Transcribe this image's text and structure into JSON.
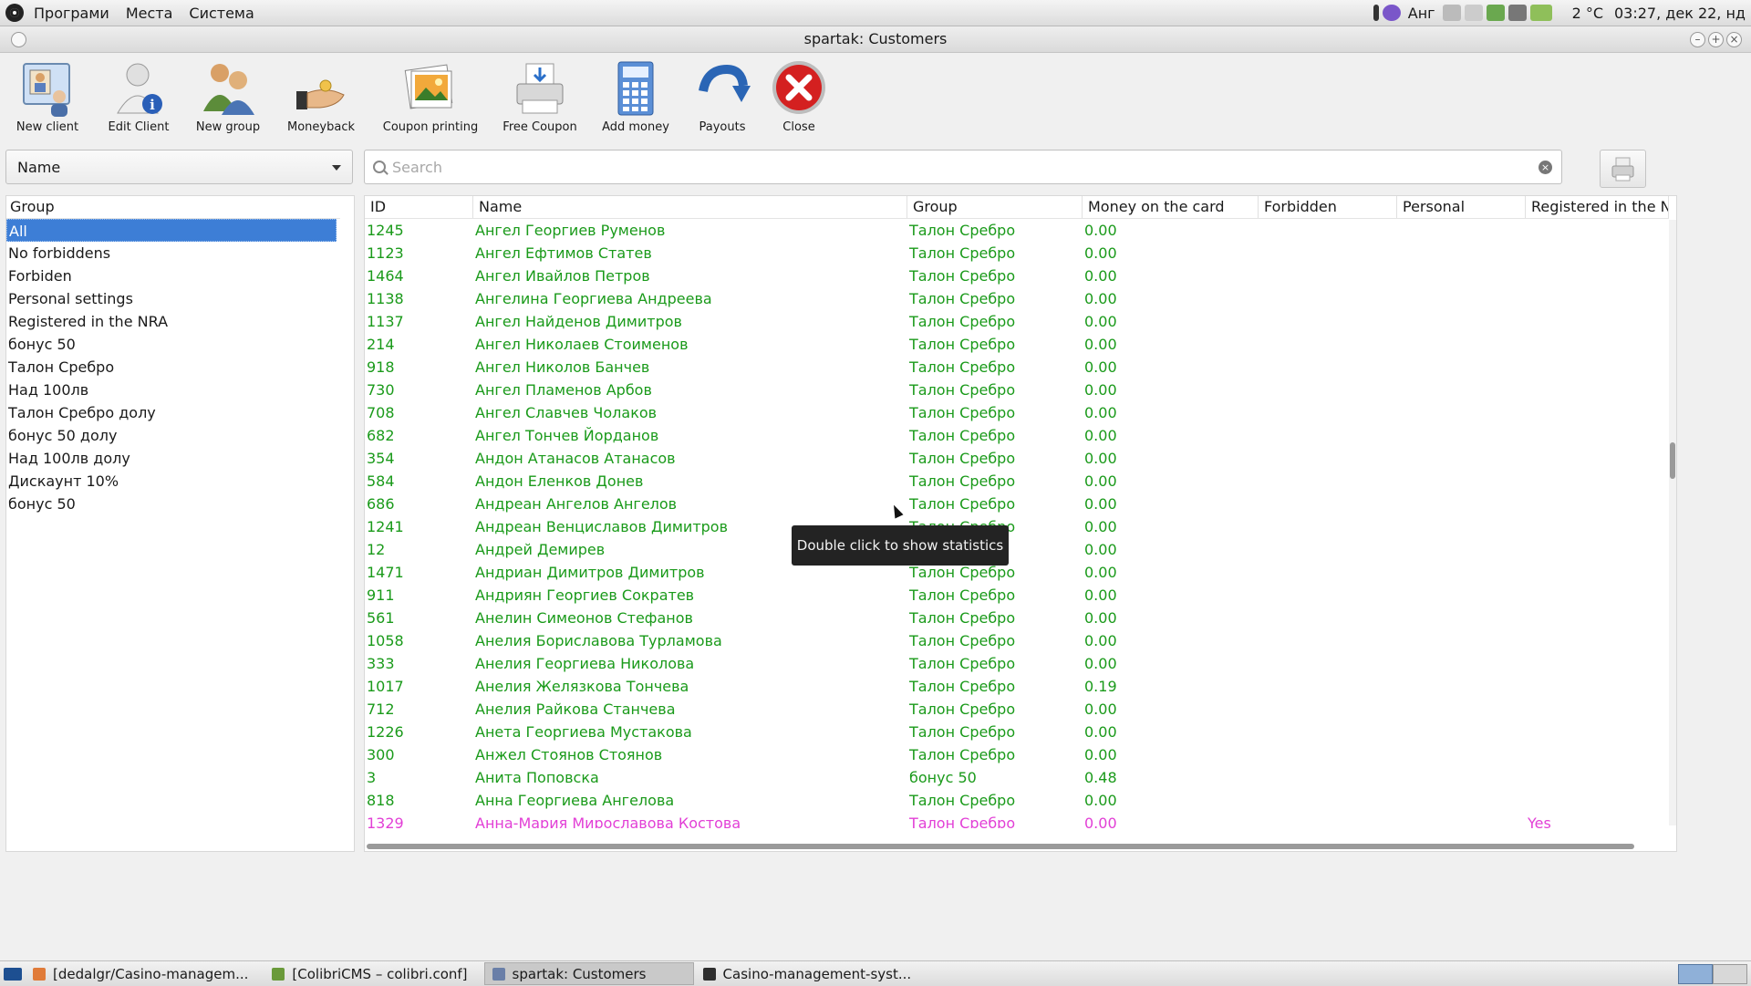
{
  "top_panel": {
    "menus": [
      "Програми",
      "Места",
      "Система"
    ],
    "tray": {
      "keyboard": "Анг",
      "temperature": "2 °C",
      "clock": "03:27, дек 22, нд"
    }
  },
  "window": {
    "title": "spartak: Customers"
  },
  "toolbar": [
    {
      "label": "New client",
      "icon": "new-client-icon"
    },
    {
      "label": "Edit Client",
      "icon": "edit-client-icon"
    },
    {
      "label": "New group",
      "icon": "new-group-icon"
    },
    {
      "label": "Moneyback",
      "icon": "moneyback-icon"
    },
    {
      "label": "Coupon printing",
      "icon": "coupon-printing-icon"
    },
    {
      "label": "Free Coupon",
      "icon": "free-coupon-icon"
    },
    {
      "label": "Add money",
      "icon": "add-money-icon"
    },
    {
      "label": "Payouts",
      "icon": "payouts-icon"
    },
    {
      "label": "Close",
      "icon": "close-icon"
    }
  ],
  "filter": {
    "field": "Name",
    "search_placeholder": "Search"
  },
  "groups": {
    "header": "Group",
    "selected": 0,
    "items": [
      "All",
      "No forbiddens",
      "Forbiden",
      "Personal settings",
      "Registered in the NRA",
      "бонус 50",
      "Талон Сребро",
      "Над 100лв",
      "Талон Сребро долу",
      "бонус 50 долу",
      "Над 100лв долу",
      "Дискаунт 10%",
      "бонус 50"
    ]
  },
  "table": {
    "columns": [
      "ID",
      "Name",
      "Group",
      "Money on the card",
      "Forbidden",
      "Personal",
      "Registered in the NF"
    ],
    "rows": [
      [
        "1245",
        "Ангел Георгиев Руменов",
        "Талон Сребро",
        "0.00",
        "",
        "",
        ""
      ],
      [
        "1123",
        "Ангел Ефтимов Статев",
        "Талон Сребро",
        "0.00",
        "",
        "",
        ""
      ],
      [
        "1464",
        "Ангел Ивайлов Петров",
        "Талон Сребро",
        "0.00",
        "",
        "",
        ""
      ],
      [
        "1138",
        "Ангелина Георгиева Андреева",
        "Талон Сребро",
        "0.00",
        "",
        "",
        ""
      ],
      [
        "1137",
        "Ангел Найденов Димитров",
        "Талон Сребро",
        "0.00",
        "",
        "",
        ""
      ],
      [
        "214",
        "Ангел Николаев Стоименов",
        "Талон Сребро",
        "0.00",
        "",
        "",
        ""
      ],
      [
        "918",
        "Ангел Николов Банчев",
        "Талон Сребро",
        "0.00",
        "",
        "",
        ""
      ],
      [
        "730",
        "Ангел Пламенов Арбов",
        "Талон Сребро",
        "0.00",
        "",
        "",
        ""
      ],
      [
        "708",
        "Ангел Славчев Чолаков",
        "Талон Сребро",
        "0.00",
        "",
        "",
        ""
      ],
      [
        "682",
        "Ангел Тончев Йорданов",
        "Талон Сребро",
        "0.00",
        "",
        "",
        ""
      ],
      [
        "354",
        "Андон Атанасов Атанасов",
        "Талон Сребро",
        "0.00",
        "",
        "",
        ""
      ],
      [
        "584",
        "Андон Еленков Донев",
        "Талон Сребро",
        "0.00",
        "",
        "",
        ""
      ],
      [
        "686",
        "Андреан Ангелов Ангелов",
        "Талон Сребро",
        "0.00",
        "",
        "",
        ""
      ],
      [
        "1241",
        "Андреан Венциславов Димитров",
        "Талон Сребро",
        "0.00",
        "",
        "",
        ""
      ],
      [
        "12",
        "Андрей Демирев",
        "",
        "0.00",
        "",
        "",
        ""
      ],
      [
        "1471",
        "Андриан Димитров Димитров",
        "Талон Сребро",
        "0.00",
        "",
        "",
        ""
      ],
      [
        "911",
        "Андриян Георгиев Сократев",
        "Талон Сребро",
        "0.00",
        "",
        "",
        ""
      ],
      [
        "561",
        "Анелин Симеонов Стефанов",
        "Талон Сребро",
        "0.00",
        "",
        "",
        ""
      ],
      [
        "1058",
        "Анелия Бориславова Турламова",
        "Талон Сребро",
        "0.00",
        "",
        "",
        ""
      ],
      [
        "333",
        "Анелия Георгиева Николова",
        "Талон Сребро",
        "0.00",
        "",
        "",
        ""
      ],
      [
        "1017",
        "Анелия Желязкова Тончева",
        "Талон Сребро",
        "0.19",
        "",
        "",
        ""
      ],
      [
        "712",
        "Анелия Райкова Станчева",
        "Талон Сребро",
        "0.00",
        "",
        "",
        ""
      ],
      [
        "1226",
        "Анета Георгиева Мустакова",
        "Талон Сребро",
        "0.00",
        "",
        "",
        ""
      ],
      [
        "300",
        "Анжел Стоянов Стоянов",
        "Талон Сребро",
        "0.00",
        "",
        "",
        ""
      ],
      [
        "3",
        "Анита Поповска",
        "бонус 50",
        "0.48",
        "",
        "",
        ""
      ],
      [
        "818",
        "Анна Георгиева Ангелова",
        "Талон Сребро",
        "0.00",
        "",
        "",
        ""
      ],
      [
        "1329",
        "Анна-Мария Мирославова Костова",
        "Талон Сребро",
        "0.00",
        "",
        "",
        "Yes"
      ]
    ],
    "highlight_rows": [
      26
    ],
    "colors": {
      "normal": "#1a9a1a",
      "highlight": "#e23fd6"
    }
  },
  "tooltip": "Double click to show statistics",
  "taskbar": [
    {
      "label": "[dedalgr/Casino-managem...",
      "active": false
    },
    {
      "label": "[ColibriCMS – colibri.conf]",
      "active": false
    },
    {
      "label": "spartak: Customers",
      "active": true
    },
    {
      "label": "Casino-management-syst...",
      "active": false
    }
  ]
}
